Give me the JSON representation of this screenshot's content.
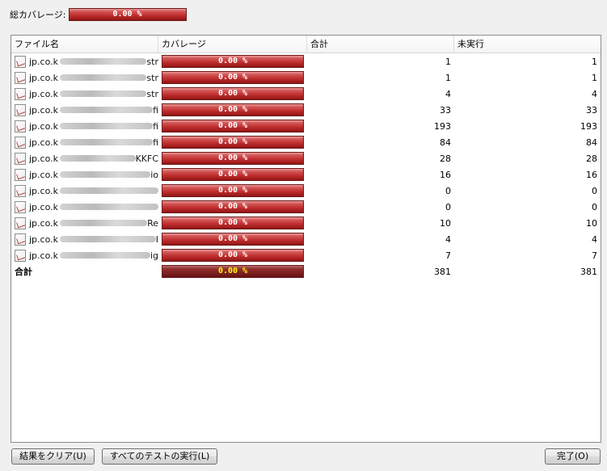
{
  "summary": {
    "label": "総カバレージ:",
    "coverage": "0.00 %"
  },
  "table": {
    "headers": {
      "file": "ファイル名",
      "coverage": "カバレージ",
      "total": "合計",
      "unexecuted": "未実行"
    },
    "rows": [
      {
        "prefix": "jp.co.k",
        "suffix": "str",
        "coverage": "0.00 %",
        "total": "1",
        "unexecuted": "1"
      },
      {
        "prefix": "jp.co.k",
        "suffix": "str",
        "coverage": "0.00 %",
        "total": "1",
        "unexecuted": "1"
      },
      {
        "prefix": "jp.co.k",
        "suffix": "str",
        "coverage": "0.00 %",
        "total": "4",
        "unexecuted": "4"
      },
      {
        "prefix": "jp.co.k",
        "suffix": "fi",
        "coverage": "0.00 %",
        "total": "33",
        "unexecuted": "33"
      },
      {
        "prefix": "jp.co.k",
        "suffix": "fi",
        "coverage": "0.00 %",
        "total": "193",
        "unexecuted": "193"
      },
      {
        "prefix": "jp.co.k",
        "suffix": "fi",
        "coverage": "0.00 %",
        "total": "84",
        "unexecuted": "84"
      },
      {
        "prefix": "jp.co.k",
        "suffix": "KKFC",
        "coverage": "0.00 %",
        "total": "28",
        "unexecuted": "28"
      },
      {
        "prefix": "jp.co.k",
        "suffix": "io",
        "coverage": "0.00 %",
        "total": "16",
        "unexecuted": "16"
      },
      {
        "prefix": "jp.co.k",
        "suffix": "",
        "coverage": "0.00 %",
        "total": "0",
        "unexecuted": "0"
      },
      {
        "prefix": "jp.co.k",
        "suffix": "",
        "coverage": "0.00 %",
        "total": "0",
        "unexecuted": "0"
      },
      {
        "prefix": "jp.co.k",
        "suffix": "Re",
        "coverage": "0.00 %",
        "total": "10",
        "unexecuted": "10"
      },
      {
        "prefix": "jp.co.k",
        "suffix": "I",
        "coverage": "0.00 %",
        "total": "4",
        "unexecuted": "4"
      },
      {
        "prefix": "jp.co.k",
        "suffix": "ig",
        "coverage": "0.00 %",
        "total": "7",
        "unexecuted": "7"
      }
    ],
    "total_row": {
      "label": "合計",
      "coverage": "0.00 %",
      "total": "381",
      "unexecuted": "381"
    }
  },
  "buttons": {
    "clear": "結果をクリア(U)",
    "run_all": "すべてのテストの実行(L)",
    "done": "完了(O)"
  },
  "colors": {
    "bar_red": "#c23131",
    "total_bar_dark_red": "#7a1e1e",
    "total_bar_text": "#ffff00",
    "background": "#f0f0f0"
  }
}
